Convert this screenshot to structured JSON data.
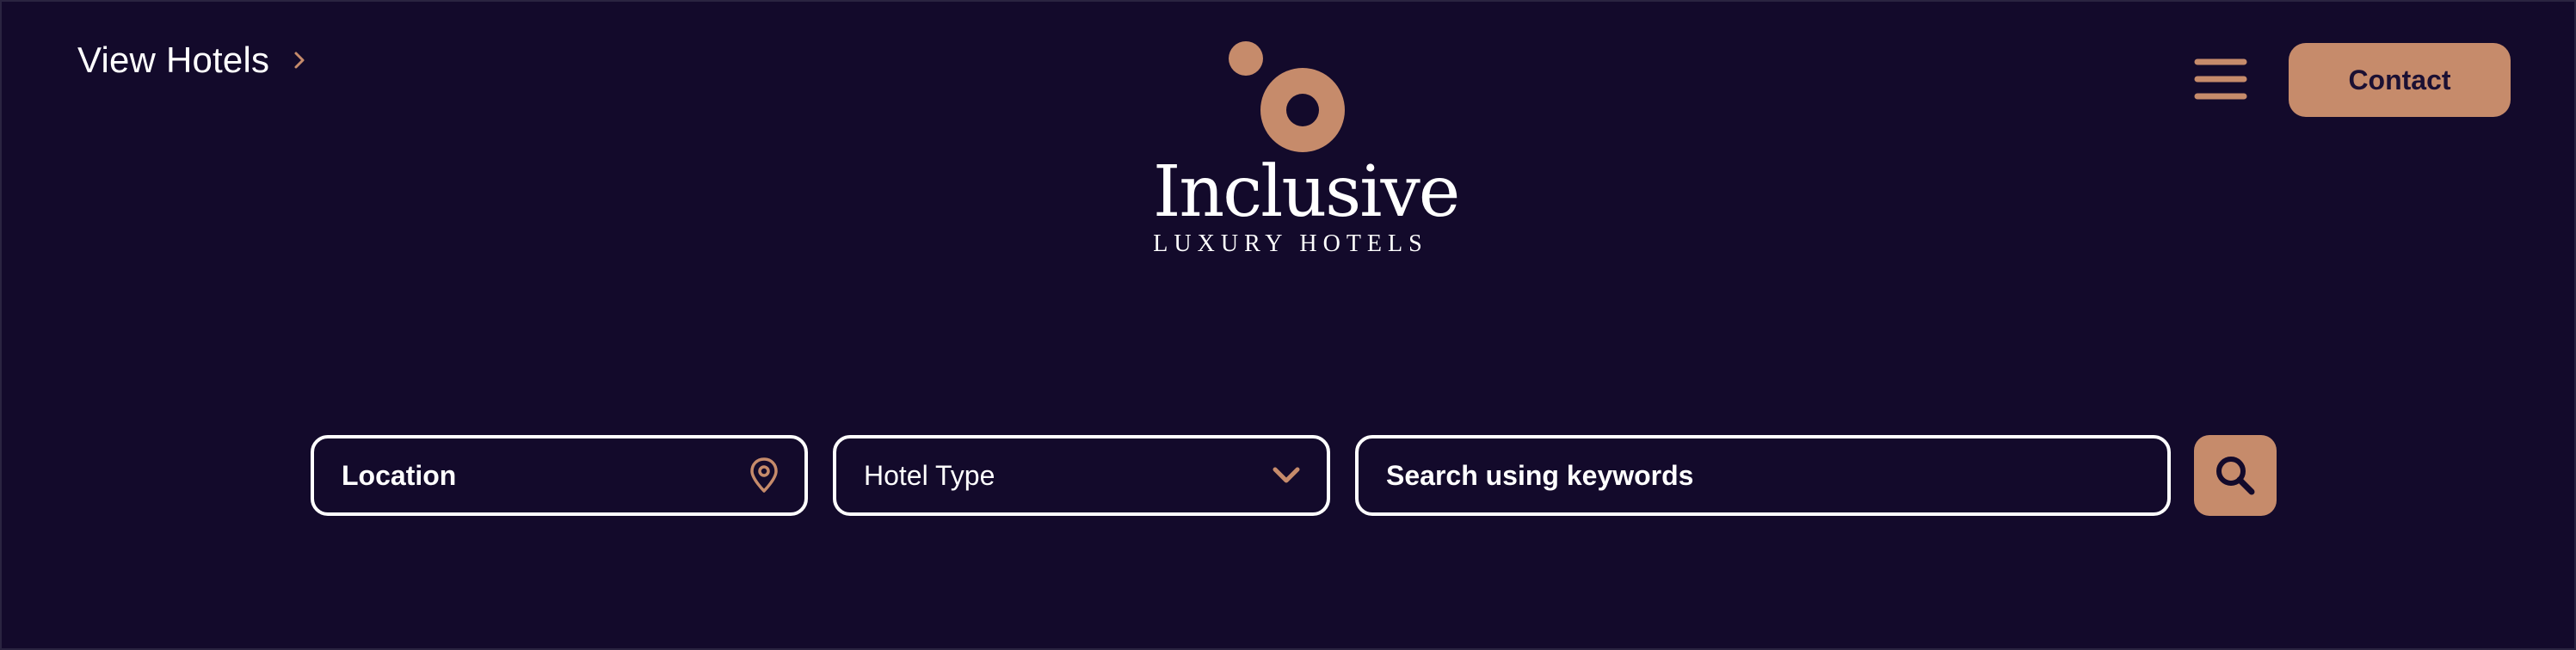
{
  "header": {
    "view_hotels_label": "View Hotels",
    "logo": {
      "wordmark": "Inclusive",
      "tagline": "LUXURY HOTELS"
    },
    "menu_icon": "hamburger-menu-icon",
    "contact_label": "Contact"
  },
  "search": {
    "location_label": "Location",
    "location_icon": "map-pin-icon",
    "hotel_type_label": "Hotel Type",
    "hotel_type_icon": "chevron-down-icon",
    "keywords_placeholder": "Search using keywords",
    "search_icon": "magnifier-icon"
  },
  "colors": {
    "background": "#130a2b",
    "accent": "#c68b6b",
    "text": "#ffffff",
    "button_text": "#1b1033"
  }
}
